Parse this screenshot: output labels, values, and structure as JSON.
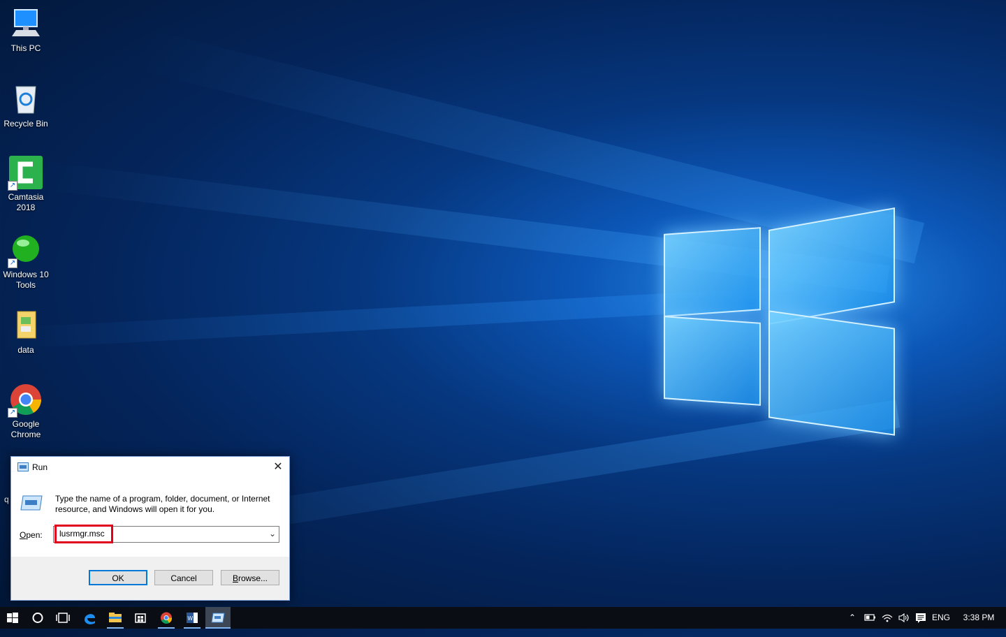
{
  "desktop": {
    "icons": [
      {
        "label": "This PC",
        "icon": "this-pc-icon"
      },
      {
        "label": "Recycle Bin",
        "icon": "recycle-bin-icon"
      },
      {
        "label": "Camtasia 2018",
        "icon": "camtasia-icon"
      },
      {
        "label": "Windows 10 Tools",
        "icon": "windows-tools-icon"
      },
      {
        "label": "data",
        "icon": "folder-icon"
      },
      {
        "label": "Google Chrome",
        "icon": "chrome-icon"
      },
      {
        "label": "q",
        "icon": "partially-hidden-icon"
      }
    ]
  },
  "run_dialog": {
    "title": "Run",
    "description": "Type the name of a program, folder, document, or Internet resource, and Windows will open it for you.",
    "open_label_prefix": "",
    "open_label_underlined": "O",
    "open_label_rest": "pen:",
    "open_value": "lusrmgr.msc",
    "ok_label": "OK",
    "cancel_label": "Cancel",
    "browse_underlined": "B",
    "browse_rest": "rowse...",
    "highlight_color": "#e0001b"
  },
  "taskbar": {
    "items": [
      "start-icon",
      "cortana-icon",
      "task-view-icon",
      "edge-icon",
      "file-explorer-icon",
      "store-icon",
      "chrome-icon",
      "word-icon",
      "run-icon"
    ],
    "tray": {
      "language": "ENG",
      "time": "3:38 PM"
    }
  },
  "colors": {
    "accent": "#0078d7",
    "taskbar": "#0a0d14"
  }
}
